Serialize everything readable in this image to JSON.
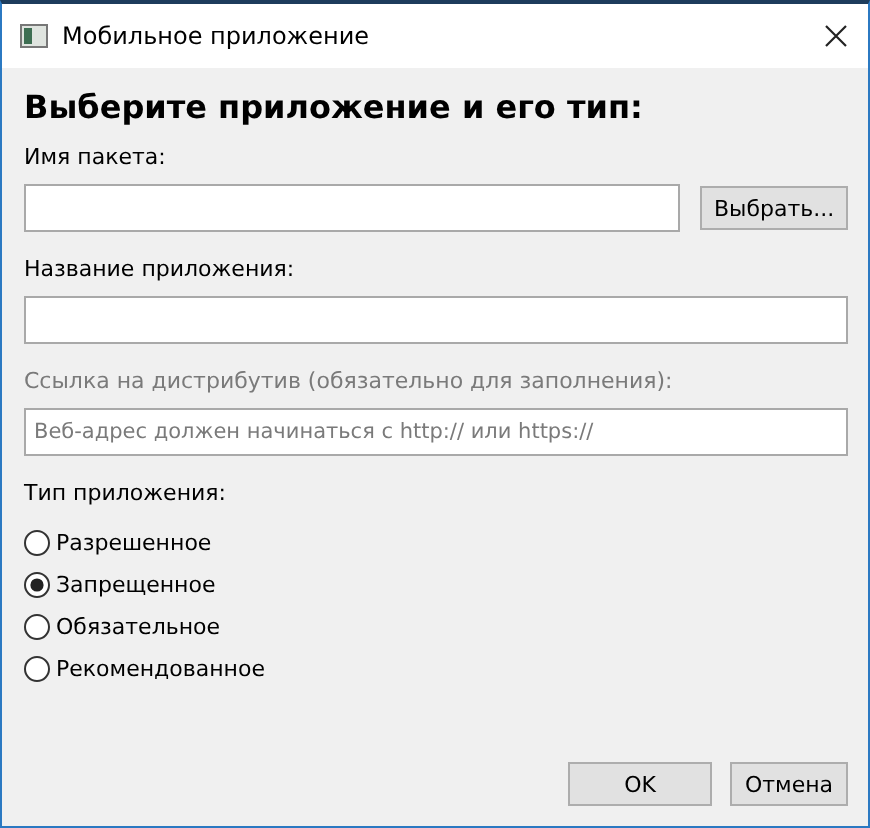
{
  "window": {
    "title": "Мобильное приложение"
  },
  "heading": "Выберите приложение и его тип:",
  "fields": [
    {
      "label": "Имя пакета:",
      "label_disabled": false,
      "button": "Выбрать..."
    },
    {
      "label": "Название приложения:",
      "label_disabled": false
    },
    {
      "label": "Ссылка на дистрибутив (обязательно для заполнения):",
      "label_disabled": true,
      "placeholder": "Веб-адрес должен начинаться с http:// или https://"
    }
  ],
  "app_type": {
    "label": "Тип приложения:",
    "options": [
      {
        "label": "Разрешенное",
        "selected": false
      },
      {
        "label": "Запрещенное",
        "selected": true
      },
      {
        "label": "Обязательное",
        "selected": false
      },
      {
        "label": "Рекомендованное",
        "selected": false
      }
    ]
  },
  "buttons": [
    "OK",
    "Отмена"
  ]
}
